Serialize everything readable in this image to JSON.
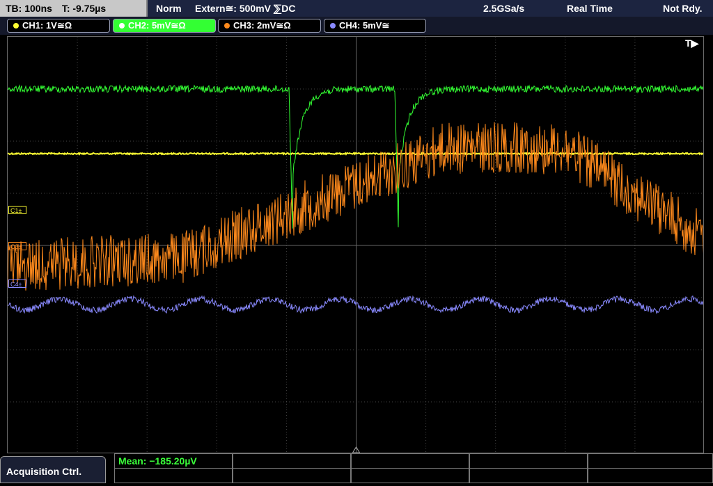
{
  "status_bar": {
    "timebase": "TB: 100ns",
    "trigger_time": "T: -9.75µs",
    "mode": "Norm",
    "trigger_source": "Extern≅: 500mV ⅀DC",
    "sample_rate": "2.5GSa/s",
    "acq_mode": "Real Time",
    "state": "Not Rdy."
  },
  "channels": [
    {
      "label": "CH1: 1V≅Ω",
      "color": "#ffff33",
      "active": false
    },
    {
      "label": "CH2: 5mV≅Ω",
      "color": "#33ff33",
      "active": true
    },
    {
      "label": "CH3: 2mV≅Ω",
      "color": "#ff8a1c",
      "active": false
    },
    {
      "label": "CH4: 5mV≅",
      "color": "#8a8aff",
      "active": false
    }
  ],
  "markers": {
    "trigger": "T▶",
    "c1": "C1±",
    "c3": "C3±",
    "c4": "C4±"
  },
  "bottom": {
    "menu_label": "Acquisition Ctrl.",
    "measurement": "Mean: −185.20µV"
  },
  "colors": {
    "ch1": "#ffff33",
    "ch2": "#33ff33",
    "ch3": "#ff8a1c",
    "ch4": "#8a8aff",
    "grid": "#444444"
  }
}
